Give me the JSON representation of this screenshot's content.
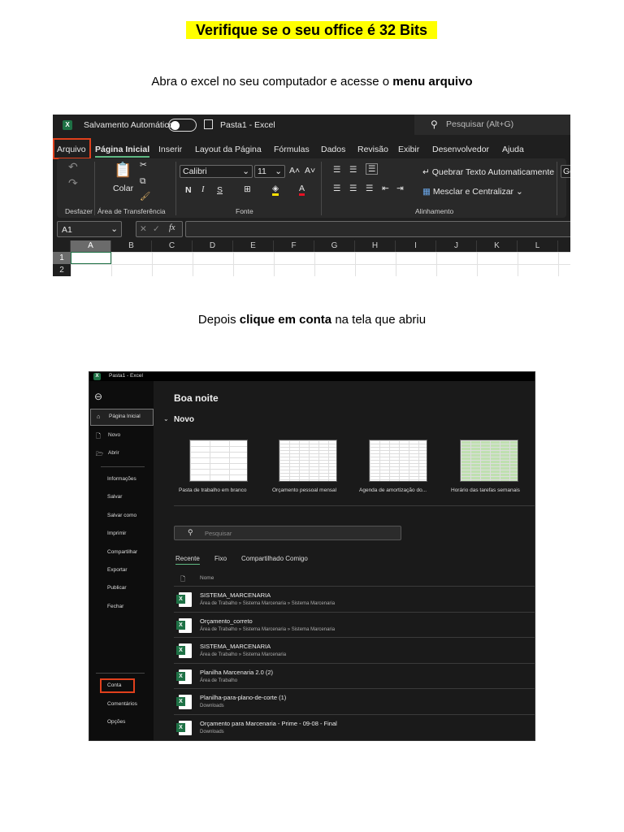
{
  "heading": "Verifique se o seu office é 32 Bits",
  "step1": {
    "text": "Abra o excel no seu computador e acesse o ",
    "bold": "menu arquivo"
  },
  "step2": {
    "pre": "Depois ",
    "bold": "clique em conta",
    "post": " na tela que abriu"
  },
  "excel": {
    "autosave": "Salvamento Automático",
    "doc_title": "Pasta1  -  Excel",
    "search": "Pesquisar (Alt+G)",
    "tabs": [
      "Arquivo",
      "Página Inicial",
      "Inserir",
      "Layout da Página",
      "Fórmulas",
      "Dados",
      "Revisão",
      "Exibir",
      "Desenvolvedor",
      "Ajuda"
    ],
    "font": "Calibri",
    "size": "11",
    "paste": "Colar",
    "bold": "N",
    "italic": "I",
    "underline": "S",
    "wrap": "Quebrar Texto Automaticamente",
    "merge": "Mesclar e Centralizar",
    "number_format": "Ge",
    "groups": [
      "Desfazer",
      "Área de Transferência",
      "Fonte",
      "Alinhamento"
    ],
    "namebox": "A1",
    "fx": "fx",
    "columns": [
      "A",
      "B",
      "C",
      "D",
      "E",
      "F",
      "G",
      "H",
      "I",
      "J",
      "K",
      "L"
    ],
    "rows": [
      "1",
      "2"
    ]
  },
  "backstage": {
    "title": "Pasta1  -  Excel",
    "sidebar_top": [
      "Página Inicial",
      "Novo",
      "Abrir"
    ],
    "sidebar_mid": [
      "Informações",
      "Salvar",
      "Salvar como",
      "Imprimir",
      "Compartilhar",
      "Exportar",
      "Publicar",
      "Fechar"
    ],
    "sidebar_bottom": [
      "Conta",
      "Comentários",
      "Opções"
    ],
    "greeting": "Boa noite",
    "new_section": "Novo",
    "templates": [
      "Pasta de trabalho em branco",
      "Orçamento pessoal mensal",
      "Agenda de amortização do...",
      "Horário das tarefas semanais"
    ],
    "search": "Pesquisar",
    "tabs": [
      "Recente",
      "Fixo",
      "Compartilhado Comigo"
    ],
    "col_name": "Nome",
    "files": [
      {
        "name": "SISTEMA_MARCENARIA",
        "path": "Área de Trabalho » Sistema Marcenaria » Sistema Marcenaria"
      },
      {
        "name": "Orçamento_correto",
        "path": "Área de Trabalho » Sistema Marcenaria » Sistema Marcenaria"
      },
      {
        "name": "SISTEMA_MARCENARIA",
        "path": "Área de Trabalho » Sistema Marcenaria"
      },
      {
        "name": "Planilha Marcenaria 2.0 (2)",
        "path": "Área de Trabalho"
      },
      {
        "name": "Planilha-para-plano-de-corte (1)",
        "path": "Downloads"
      },
      {
        "name": "Orçamento para Marcenaria - Prime - 09-08 - Final",
        "path": "Downloads"
      }
    ]
  },
  "colors": {
    "highlight": "#ffff00",
    "excel_green": "#1e7145",
    "callout": "#e0401c"
  }
}
